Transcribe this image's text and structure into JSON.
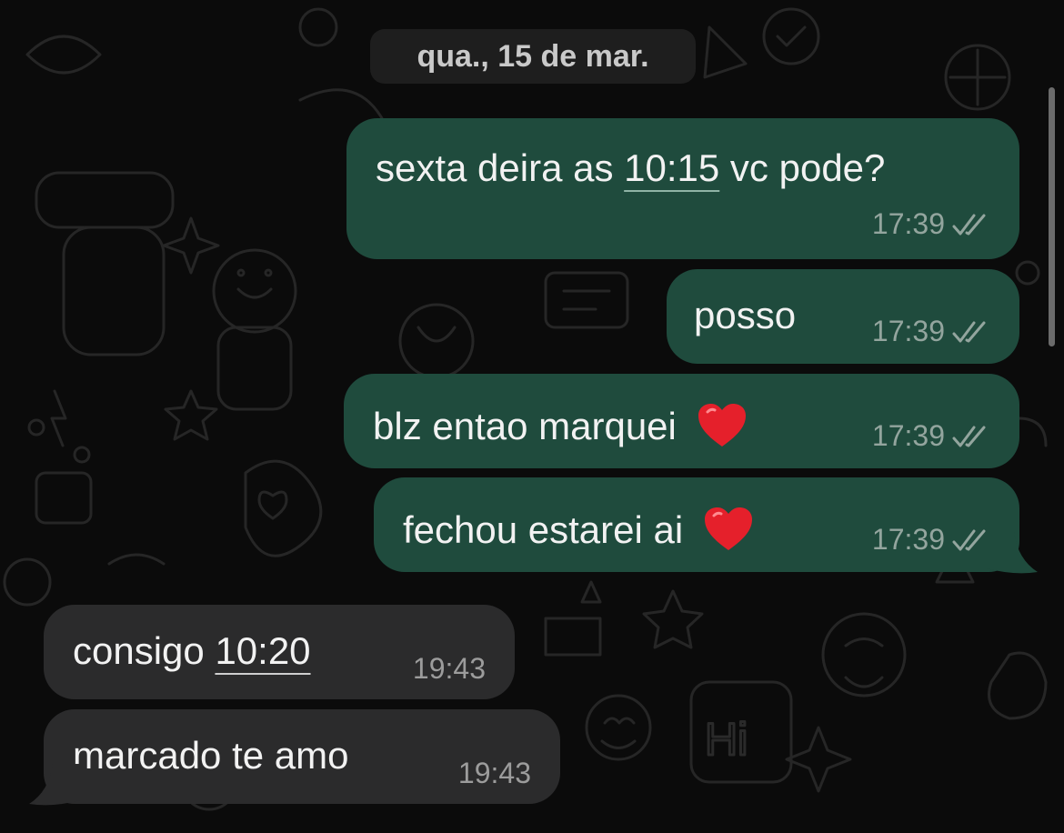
{
  "chat": {
    "date_chip": "qua., 15 de mar.",
    "messages": [
      {
        "direction": "outgoing",
        "text_before": "sexta deira as ",
        "link": "10:15",
        "text_after": " vc pode?",
        "time": "17:39",
        "status": "read"
      },
      {
        "direction": "outgoing",
        "text": "posso",
        "time": "17:39",
        "status": "read"
      },
      {
        "direction": "outgoing",
        "text": "blz entao marquei",
        "emoji": "red-heart",
        "time": "17:39",
        "status": "read"
      },
      {
        "direction": "outgoing",
        "text": "fechou estarei ai",
        "emoji": "red-heart",
        "time": "17:39",
        "status": "read"
      },
      {
        "direction": "incoming",
        "text_before": "consigo ",
        "link": "10:20",
        "time": "19:43"
      },
      {
        "direction": "incoming",
        "text": "marcado te amo",
        "time": "19:43"
      }
    ]
  },
  "colors": {
    "outgoing_bubble": "#1f4b3d",
    "incoming_bubble": "#2b2b2c",
    "background": "#0b0b0b",
    "read_ticks": "#93a59e"
  }
}
